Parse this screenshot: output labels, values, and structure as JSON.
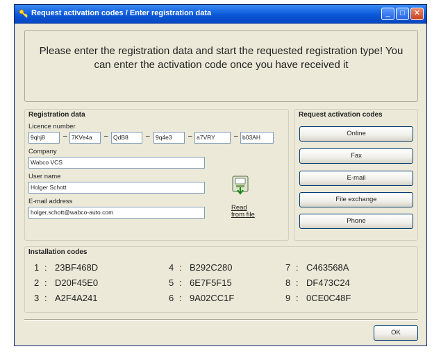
{
  "window": {
    "title": "Request activation codes / Enter registration data",
    "minimize": "_",
    "maximize": "□",
    "close": "✕"
  },
  "instruction": "Please enter the registration data and start the requested registration type! You can enter the activation code once you have received it",
  "registration": {
    "group_label": "Registration data",
    "licence_label": "Licence number",
    "licence_parts": [
      "9qhj8",
      "7KVe4a",
      "QdB8",
      "9q4e3",
      "a7VRY",
      "b03AH"
    ],
    "company_label": "Company",
    "company_value": "Wabco VCS",
    "username_label": "User name",
    "username_value": "Holger Schott",
    "email_label": "E-mail address",
    "email_value": "holger.schott@wabco-auto.com",
    "read_from_file": "Read from file"
  },
  "request": {
    "group_label": "Request activation codes",
    "buttons": [
      "Online",
      "Fax",
      "E-mail",
      "File exchange",
      "Phone"
    ]
  },
  "installation": {
    "group_label": "Installation codes",
    "codes": [
      {
        "num": "1",
        "code": "23BF468D"
      },
      {
        "num": "2",
        "code": "D20F45E0"
      },
      {
        "num": "3",
        "code": "A2F4A241"
      },
      {
        "num": "4",
        "code": "B292C280"
      },
      {
        "num": "5",
        "code": "6E7F5F15"
      },
      {
        "num": "6",
        "code": "9A02CC1F"
      },
      {
        "num": "7",
        "code": "C463568A"
      },
      {
        "num": "8",
        "code": "DF473C24"
      },
      {
        "num": "9",
        "code": "0CE0C48F"
      }
    ]
  },
  "ok_label": "OK"
}
